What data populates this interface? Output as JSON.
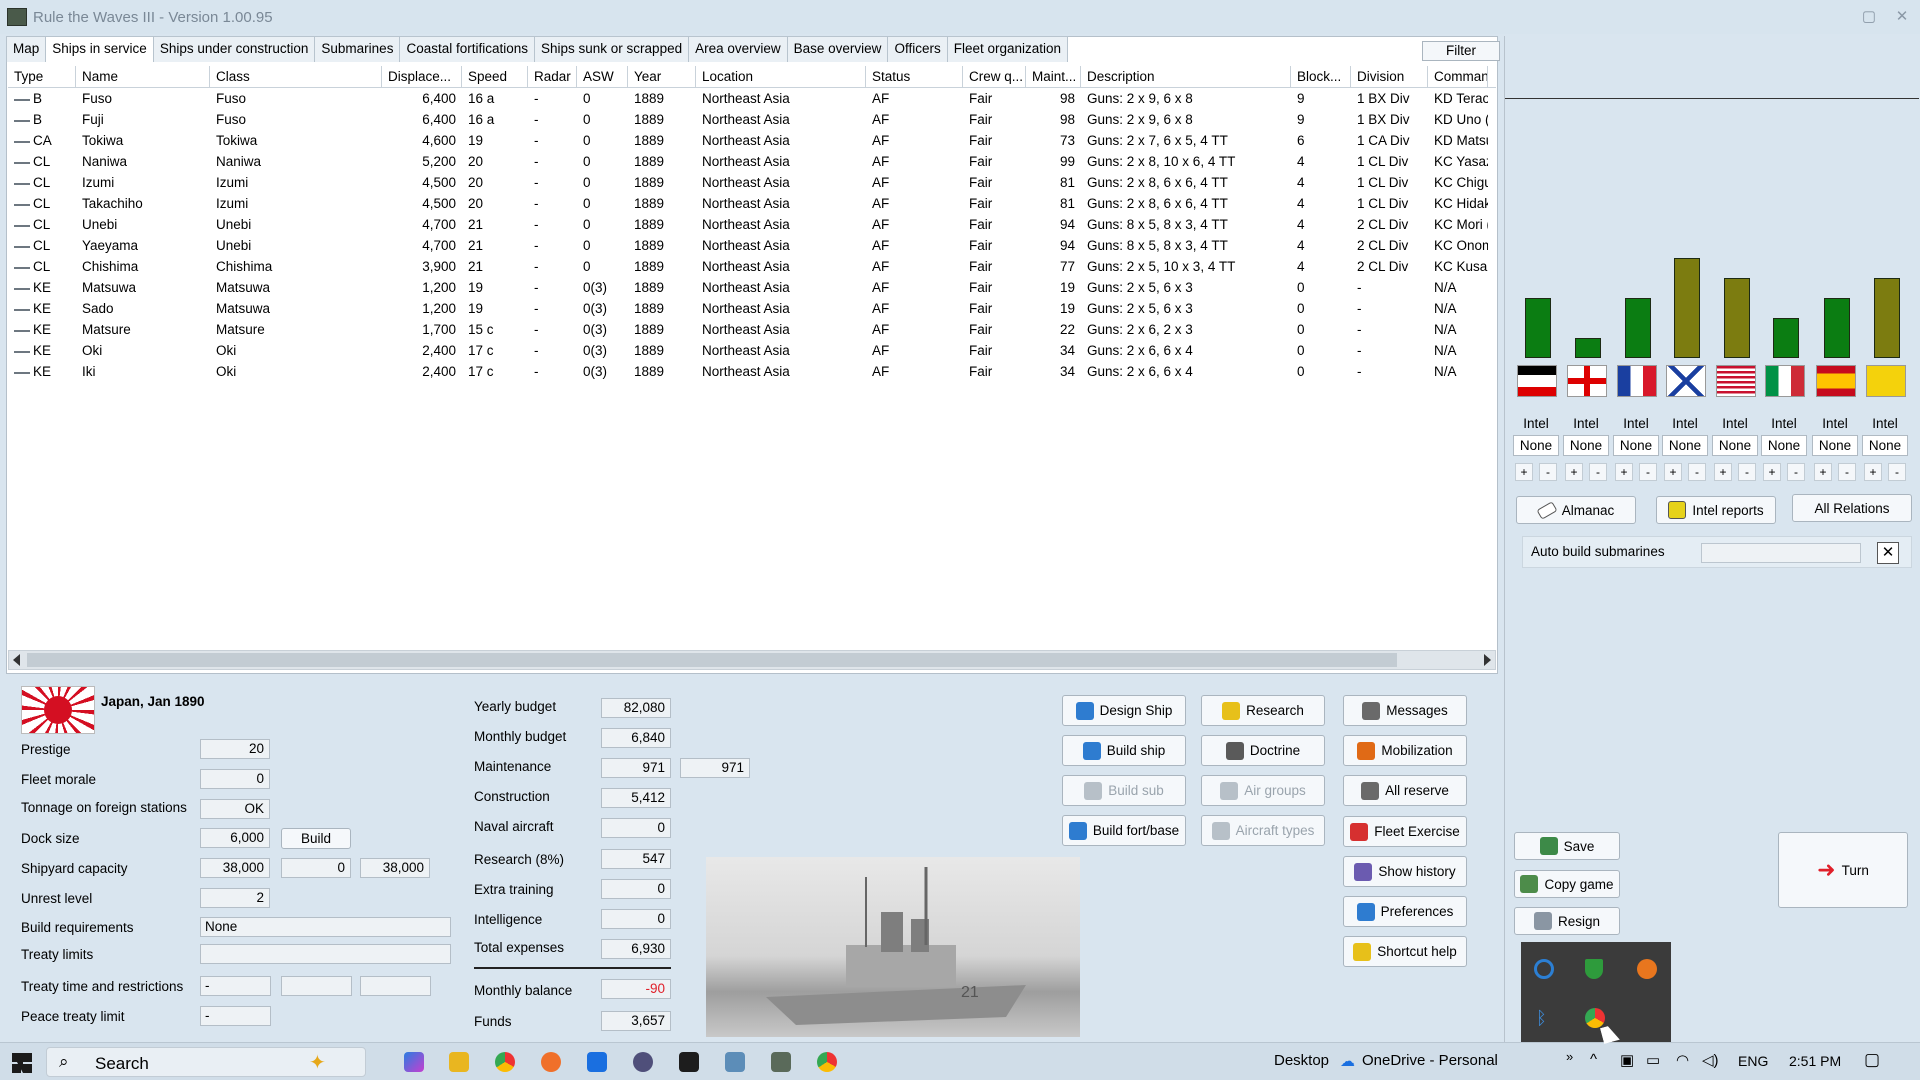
{
  "window": {
    "title": "Rule the Waves III - Version 1.00.95"
  },
  "tabs": [
    "Map",
    "Ships in service",
    "Ships under construction",
    "Submarines",
    "Coastal fortifications",
    "Ships sunk or scrapped",
    "Area overview",
    "Base overview",
    "Officers",
    "Fleet organization"
  ],
  "filter_label": "Filter",
  "columns": [
    "Type",
    "Name",
    "Class",
    "Displace...",
    "Speed",
    "Radar",
    "ASW",
    "Year",
    "Location",
    "Status",
    "Crew q...",
    "Maint...",
    "Description",
    "Block...",
    "Division",
    "Command"
  ],
  "ships": [
    {
      "type": "B",
      "name": "Fuso",
      "class": "Fuso",
      "disp": "6,400",
      "speed": "16 a",
      "radar": "-",
      "asw": "0",
      "year": "1889",
      "loc": "Northeast Asia",
      "status": "AF",
      "crew": "Fair",
      "maint": "98",
      "desc": "Guns: 2 x 9, 6 x 8",
      "block": "9",
      "div": "1 BX Div",
      "cmd": "KD Teraok"
    },
    {
      "type": "B",
      "name": "Fuji",
      "class": "Fuso",
      "disp": "6,400",
      "speed": "16 a",
      "radar": "-",
      "asw": "0",
      "year": "1889",
      "loc": "Northeast Asia",
      "status": "AF",
      "crew": "Fair",
      "maint": "98",
      "desc": "Guns: 2 x 9, 6 x 8",
      "block": "9",
      "div": "1 BX Div",
      "cmd": "KD Uno (?)"
    },
    {
      "type": "CA",
      "name": "Tokiwa",
      "class": "Tokiwa",
      "disp": "4,600",
      "speed": "19",
      "radar": "-",
      "asw": "0",
      "year": "1889",
      "loc": "Northeast Asia",
      "status": "AF",
      "crew": "Fair",
      "maint": "73",
      "desc": "Guns: 2 x 7, 6 x 5, 4 TT",
      "block": "6",
      "div": "1 CA Div",
      "cmd": "KD Matsus"
    },
    {
      "type": "CL",
      "name": "Naniwa",
      "class": "Naniwa",
      "disp": "5,200",
      "speed": "20",
      "radar": "-",
      "asw": "0",
      "year": "1889",
      "loc": "Northeast Asia",
      "status": "AF",
      "crew": "Fair",
      "maint": "99",
      "desc": "Guns: 2 x 8, 10 x 6, 4 TT",
      "block": "4",
      "div": "1 CL Div",
      "cmd": "KC Yasazu"
    },
    {
      "type": "CL",
      "name": "Izumi",
      "class": "Izumi",
      "disp": "4,500",
      "speed": "20",
      "radar": "-",
      "asw": "0",
      "year": "1889",
      "loc": "Northeast Asia",
      "status": "AF",
      "crew": "Fair",
      "maint": "81",
      "desc": "Guns: 2 x 8, 6 x 6, 4 TT",
      "block": "4",
      "div": "1 CL Div",
      "cmd": "KC Chigus"
    },
    {
      "type": "CL",
      "name": "Takachiho",
      "class": "Izumi",
      "disp": "4,500",
      "speed": "20",
      "radar": "-",
      "asw": "0",
      "year": "1889",
      "loc": "Northeast Asia",
      "status": "AF",
      "crew": "Fair",
      "maint": "81",
      "desc": "Guns: 2 x 8, 6 x 6, 4 TT",
      "block": "4",
      "div": "1 CL Div",
      "cmd": "KC Hidaka"
    },
    {
      "type": "CL",
      "name": "Unebi",
      "class": "Unebi",
      "disp": "4,700",
      "speed": "21",
      "radar": "-",
      "asw": "0",
      "year": "1889",
      "loc": "Northeast Asia",
      "status": "AF",
      "crew": "Fair",
      "maint": "94",
      "desc": "Guns: 8 x 5, 8 x 3, 4 TT",
      "block": "4",
      "div": "2 CL Div",
      "cmd": "KC Mori (?)"
    },
    {
      "type": "CL",
      "name": "Yaeyama",
      "class": "Unebi",
      "disp": "4,700",
      "speed": "21",
      "radar": "-",
      "asw": "0",
      "year": "1889",
      "loc": "Northeast Asia",
      "status": "AF",
      "crew": "Fair",
      "maint": "94",
      "desc": "Guns: 8 x 5, 8 x 3, 4 TT",
      "block": "4",
      "div": "2 CL Div",
      "cmd": "KC Onomc"
    },
    {
      "type": "CL",
      "name": "Chishima",
      "class": "Chishima",
      "disp": "3,900",
      "speed": "21",
      "radar": "-",
      "asw": "0",
      "year": "1889",
      "loc": "Northeast Asia",
      "status": "AF",
      "crew": "Fair",
      "maint": "77",
      "desc": "Guns: 2 x 5, 10 x 3, 4 TT",
      "block": "4",
      "div": "2 CL Div",
      "cmd": "KC Kusake"
    },
    {
      "type": "KE",
      "name": "Matsuwa",
      "class": "Matsuwa",
      "disp": "1,200",
      "speed": "19",
      "radar": "-",
      "asw": "0(3)",
      "year": "1889",
      "loc": "Northeast Asia",
      "status": "AF",
      "crew": "Fair",
      "maint": "19",
      "desc": "Guns: 2 x 5, 6 x 3",
      "block": "0",
      "div": "-",
      "cmd": "N/A"
    },
    {
      "type": "KE",
      "name": "Sado",
      "class": "Matsuwa",
      "disp": "1,200",
      "speed": "19",
      "radar": "-",
      "asw": "0(3)",
      "year": "1889",
      "loc": "Northeast Asia",
      "status": "AF",
      "crew": "Fair",
      "maint": "19",
      "desc": "Guns: 2 x 5, 6 x 3",
      "block": "0",
      "div": "-",
      "cmd": "N/A"
    },
    {
      "type": "KE",
      "name": "Matsure",
      "class": "Matsure",
      "disp": "1,700",
      "speed": "15 c",
      "radar": "-",
      "asw": "0(3)",
      "year": "1889",
      "loc": "Northeast Asia",
      "status": "AF",
      "crew": "Fair",
      "maint": "22",
      "desc": "Guns: 2 x 6, 2 x 3",
      "block": "0",
      "div": "-",
      "cmd": "N/A"
    },
    {
      "type": "KE",
      "name": "Oki",
      "class": "Oki",
      "disp": "2,400",
      "speed": "17 c",
      "radar": "-",
      "asw": "0(3)",
      "year": "1889",
      "loc": "Northeast Asia",
      "status": "AF",
      "crew": "Fair",
      "maint": "34",
      "desc": "Guns: 2 x 6, 6 x 4",
      "block": "0",
      "div": "-",
      "cmd": "N/A"
    },
    {
      "type": "KE",
      "name": "Iki",
      "class": "Oki",
      "disp": "2,400",
      "speed": "17 c",
      "radar": "-",
      "asw": "0(3)",
      "year": "1889",
      "loc": "Northeast Asia",
      "status": "AF",
      "crew": "Fair",
      "maint": "34",
      "desc": "Guns: 2 x 6, 6 x 4",
      "block": "0",
      "div": "-",
      "cmd": "N/A"
    }
  ],
  "nation": {
    "title": "Japan, Jan 1890"
  },
  "stats": {
    "prestige_label": "Prestige",
    "prestige": "20",
    "morale_label": "Fleet morale",
    "morale": "0",
    "tonnage_label": "Tonnage on foreign stations",
    "tonnage": "OK",
    "dock_label": "Dock size",
    "dock": "6,000",
    "dock_build": "Build",
    "shipyard_label": "Shipyard capacity",
    "shipyard1": "38,000",
    "shipyard2": "0",
    "shipyard3": "38,000",
    "unrest_label": "Unrest level",
    "unrest": "2",
    "buildreq_label": "Build requirements",
    "buildreq": "None",
    "treaty_label": "Treaty limits",
    "treatytime_label": "Treaty time and restrictions",
    "treatytime": "-",
    "peace_label": "Peace treaty limit",
    "peace": "-"
  },
  "budget": {
    "yearly_label": "Yearly budget",
    "yearly": "82,080",
    "monthly_label": "Monthly budget",
    "monthly": "6,840",
    "maint_label": "Maintenance",
    "maint": "971",
    "maint2": "971",
    "constr_label": "Construction",
    "constr": "5,412",
    "naval_label": "Naval aircraft",
    "naval": "0",
    "research_label": "Research (8%)",
    "research": "547",
    "extra_label": "Extra training",
    "extra": "0",
    "intel_label": "Intelligence",
    "intel": "0",
    "total_label": "Total expenses",
    "total": "6,930",
    "balance_label": "Monthly balance",
    "balance": "-90",
    "funds_label": "Funds",
    "funds": "3,657"
  },
  "actions": {
    "design": "Design Ship",
    "research": "Research",
    "messages": "Messages",
    "build": "Build ship",
    "doctrine": "Doctrine",
    "mobilization": "Mobilization",
    "buildsub": "Build sub",
    "airgroups": "Air groups",
    "reserve": "All reserve",
    "fort": "Build fort/base",
    "aircraft": "Aircraft types",
    "exercise": "Fleet Exercise",
    "history": "Show history",
    "prefs": "Preferences",
    "shortcut": "Shortcut help"
  },
  "relations": {
    "bars": [
      0.3,
      0.1,
      0.3,
      0.5,
      0.4,
      0.2,
      0.3,
      0.4
    ],
    "bar_colors": [
      "#0b7d12",
      "#0b7d12",
      "#0b7d12",
      "#7c7c10",
      "#7c7c10",
      "#0b7d12",
      "#0b7d12",
      "#7c7c10"
    ],
    "intel_label": "Intel",
    "intel_value": "None",
    "almanac": "Almanac",
    "intel_reports": "Intel reports",
    "all_relations": "All Relations",
    "auto_sub": "Auto build submarines"
  },
  "game_buttons": {
    "save": "Save",
    "copy": "Copy game",
    "resign": "Resign",
    "turn": "Turn"
  },
  "taskbar": {
    "search": "Search",
    "desktop": "Desktop",
    "onedrive": "OneDrive - Personal",
    "lang": "ENG",
    "time": "2:51 PM"
  }
}
